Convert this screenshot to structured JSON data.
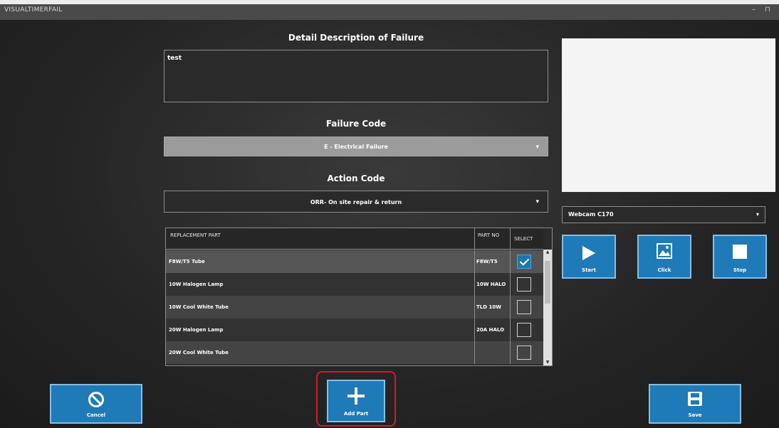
{
  "window": {
    "title": "VISUALTIMERFAIL",
    "minimize": "–",
    "restore": "⊓"
  },
  "description": {
    "title": "Detail Description of Failure",
    "value": "test"
  },
  "failure_code": {
    "title": "Failure Code",
    "selected": "E - Electrical Failure"
  },
  "action_code": {
    "title": "Action Code",
    "selected": "ORR- On site repair & return"
  },
  "webcam": {
    "device": "Webcam C170"
  },
  "parts_table": {
    "headers": {
      "part": "REPLACEMENT PART",
      "part_no": "PART NO",
      "select": "SELECT"
    },
    "rows": [
      {
        "part": "F8W/T5 Tube",
        "part_no": "F8W/T5",
        "selected": true
      },
      {
        "part": "10W Halogen Lamp",
        "part_no": "10W HALO",
        "selected": false
      },
      {
        "part": "10W Cool White Tube",
        "part_no": "TLD 10W",
        "selected": false
      },
      {
        "part": "20W Halogen Lamp",
        "part_no": "20A HALO",
        "selected": false
      },
      {
        "part": "20W Cool White Tube",
        "part_no": "",
        "selected": false
      }
    ]
  },
  "buttons": {
    "start": "Start",
    "click": "Click",
    "stop": "Stop",
    "cancel": "Cancel",
    "add_part": "Add Part",
    "save": "Save"
  },
  "colors": {
    "button": "#1f7ab8",
    "highlight": "#d41c2a",
    "selected_check": "#1b77b0"
  }
}
